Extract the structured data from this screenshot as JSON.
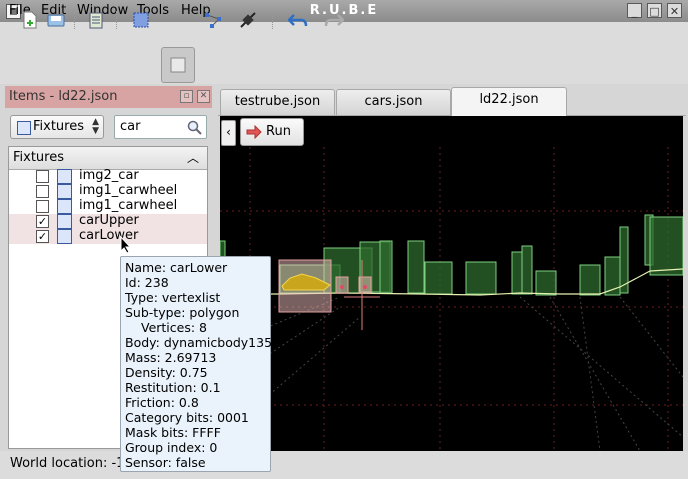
{
  "window": {
    "title": "R.U.B.E"
  },
  "menubar": {
    "items": [
      {
        "label": "File"
      },
      {
        "label": "Edit"
      },
      {
        "label": "Window"
      },
      {
        "label": "Tools"
      },
      {
        "label": "Help"
      }
    ]
  },
  "toolbar": {
    "icons": [
      "new-scene-icon",
      "save-icon",
      "clipboard-icon",
      "select-rect-icon",
      "box-select-icon",
      "vertex-edit-icon",
      "plug-icon",
      "undo-icon",
      "redo-icon"
    ]
  },
  "items_panel": {
    "title": "Items - ld22.json",
    "type_select": "Fixtures",
    "search_value": "car",
    "column_header": "Fixtures",
    "rows": [
      {
        "label": "img2_car",
        "checked": false
      },
      {
        "label": "img1_carwheel",
        "checked": false
      },
      {
        "label": "img1_carwheel",
        "checked": false
      },
      {
        "label": "carUpper",
        "checked": true
      },
      {
        "label": "carLower",
        "checked": true
      }
    ]
  },
  "tabs": [
    {
      "label": "testrube.json"
    },
    {
      "label": "cars.json"
    },
    {
      "label": "ld22.json",
      "active": true
    }
  ],
  "scene": {
    "run_label": "Run"
  },
  "tooltip": {
    "lines": [
      {
        "text": "Name: carLower"
      },
      {
        "text": "Id: 238"
      },
      {
        "text": "Type: vertexlist"
      },
      {
        "text": "Sub-type: polygon"
      },
      {
        "text": "Vertices: 8",
        "indent": true
      },
      {
        "text": "Body: dynamicbody135"
      },
      {
        "text": "Mass: 2.69713"
      },
      {
        "text": "Density: 0.75"
      },
      {
        "text": "Restitution: 0.1"
      },
      {
        "text": "Friction: 0.8"
      },
      {
        "text": "Category bits: 0001"
      },
      {
        "text": "Mask bits: FFFF"
      },
      {
        "text": "Group index: 0"
      },
      {
        "text": "Sensor: false"
      }
    ]
  },
  "statusbar": {
    "text": "World location: -1"
  },
  "colors": {
    "fixture_fill": "#2d6b2d",
    "fixture_stroke": "#7fd07f",
    "selection": "#f1e3e3",
    "panel_title": "#d8a3a3"
  }
}
